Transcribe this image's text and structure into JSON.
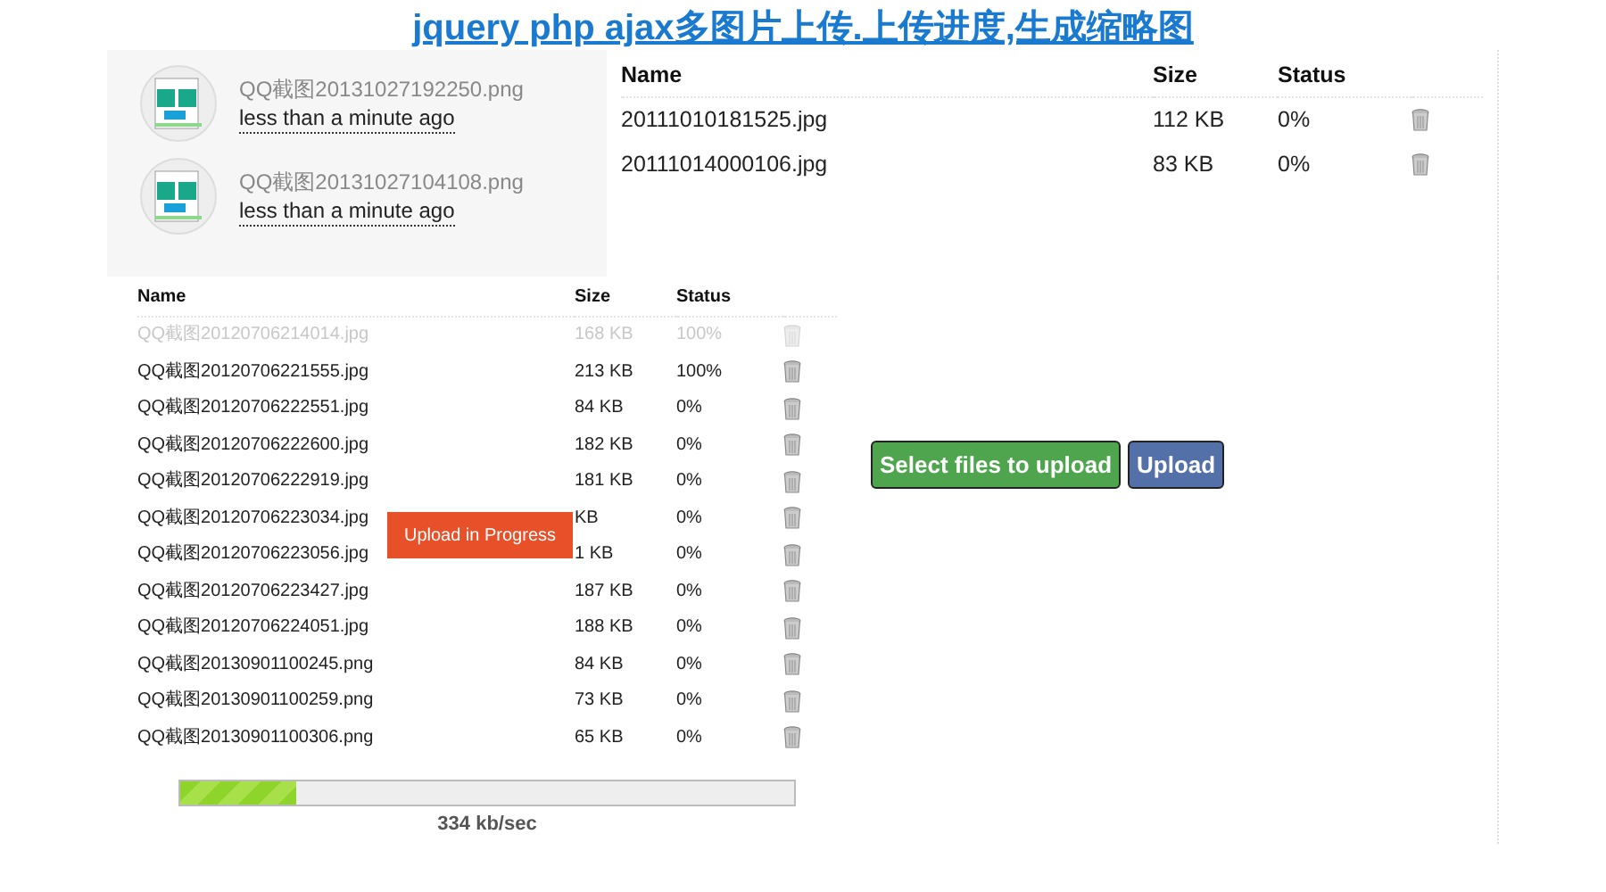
{
  "title": "jquery php ajax多图片上传.上传进度,生成缩略图",
  "thumbnails": [
    {
      "name": "QQ截图20131027192250.png",
      "time": "less than a minute ago"
    },
    {
      "name": "QQ截图20131027104108.png",
      "time": "less than a minute ago"
    }
  ],
  "top_table": {
    "columns": [
      "Name",
      "Size",
      "Status"
    ],
    "rows": [
      {
        "name": "20111010181525.jpg",
        "size": "112 KB",
        "status": "0%",
        "faded": false
      },
      {
        "name": "20111014000106.jpg",
        "size": "83 KB",
        "status": "0%",
        "faded": false
      }
    ]
  },
  "queue_table": {
    "columns": [
      "Name",
      "Size",
      "Status"
    ],
    "rows": [
      {
        "name": "QQ截图20120706214014.jpg",
        "size": "168 KB",
        "status": "100%",
        "faded": true
      },
      {
        "name": "QQ截图20120706221555.jpg",
        "size": "213 KB",
        "status": "100%",
        "faded": false
      },
      {
        "name": "QQ截图20120706222551.jpg",
        "size": "84 KB",
        "status": "0%",
        "faded": false
      },
      {
        "name": "QQ截图20120706222600.jpg",
        "size": "182 KB",
        "status": "0%",
        "faded": false
      },
      {
        "name": "QQ截图20120706222919.jpg",
        "size": "181 KB",
        "status": "0%",
        "faded": false
      },
      {
        "name": "QQ截图20120706223034.jpg",
        "size": "KB",
        "status": "0%",
        "faded": false
      },
      {
        "name": "QQ截图20120706223056.jpg",
        "size": "1 KB",
        "status": "0%",
        "faded": false
      },
      {
        "name": "QQ截图20120706223427.jpg",
        "size": "187 KB",
        "status": "0%",
        "faded": false
      },
      {
        "name": "QQ截图20120706224051.jpg",
        "size": "188 KB",
        "status": "0%",
        "faded": false
      },
      {
        "name": "QQ截图20130901100245.png",
        "size": "84 KB",
        "status": "0%",
        "faded": false
      },
      {
        "name": "QQ截图20130901100259.png",
        "size": "73 KB",
        "status": "0%",
        "faded": false
      },
      {
        "name": "QQ截图20130901100306.png",
        "size": "65 KB",
        "status": "0%",
        "faded": false
      }
    ]
  },
  "toast": "Upload in Progress",
  "progress": {
    "level": 0.19,
    "speed": "334 kb/sec"
  },
  "buttons": [
    {
      "label": "Select files to upload",
      "kind": "select"
    },
    {
      "label": "Upload",
      "kind": "upload"
    }
  ]
}
